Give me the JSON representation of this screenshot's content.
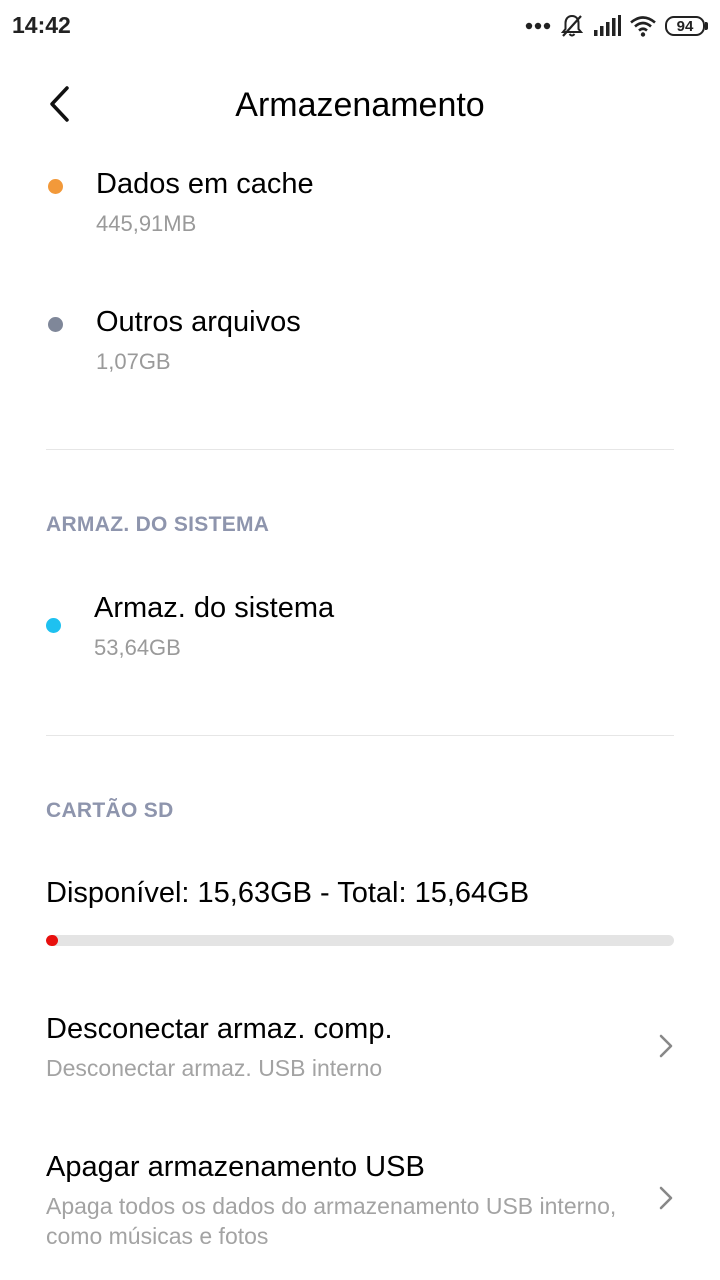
{
  "status_bar": {
    "time": "14:42",
    "battery": "94",
    "icons": [
      "more-dots-icon",
      "silent-bell-icon",
      "signal-icon",
      "wifi-icon",
      "battery-icon"
    ]
  },
  "header": {
    "title": "Armazenamento",
    "back_icon": "back-arrow-icon"
  },
  "storage_items": [
    {
      "label": "Dados em cache",
      "size": "445,91MB",
      "color": "#F2993A"
    },
    {
      "label": "Outros arquivos",
      "size": "1,07GB",
      "color": "#7F8799"
    }
  ],
  "system_section": {
    "header": "ARMAZ. DO SISTEMA",
    "item": {
      "label": "Armaz. do sistema",
      "size": "53,64GB",
      "color": "#1EC1F0"
    }
  },
  "sd_section": {
    "header": "CARTÃO SD",
    "summary": "Disponível: 15,63GB - Total: 15,64GB",
    "used_fraction": 0.0006,
    "bar_color": "#E8100E"
  },
  "menu": [
    {
      "title": "Desconectar armaz. comp.",
      "subtitle": "Desconectar armaz. USB interno"
    },
    {
      "title": "Apagar armazenamento USB",
      "subtitle": "Apaga todos os dados do armazenamento USB interno, como músicas e fotos"
    }
  ]
}
